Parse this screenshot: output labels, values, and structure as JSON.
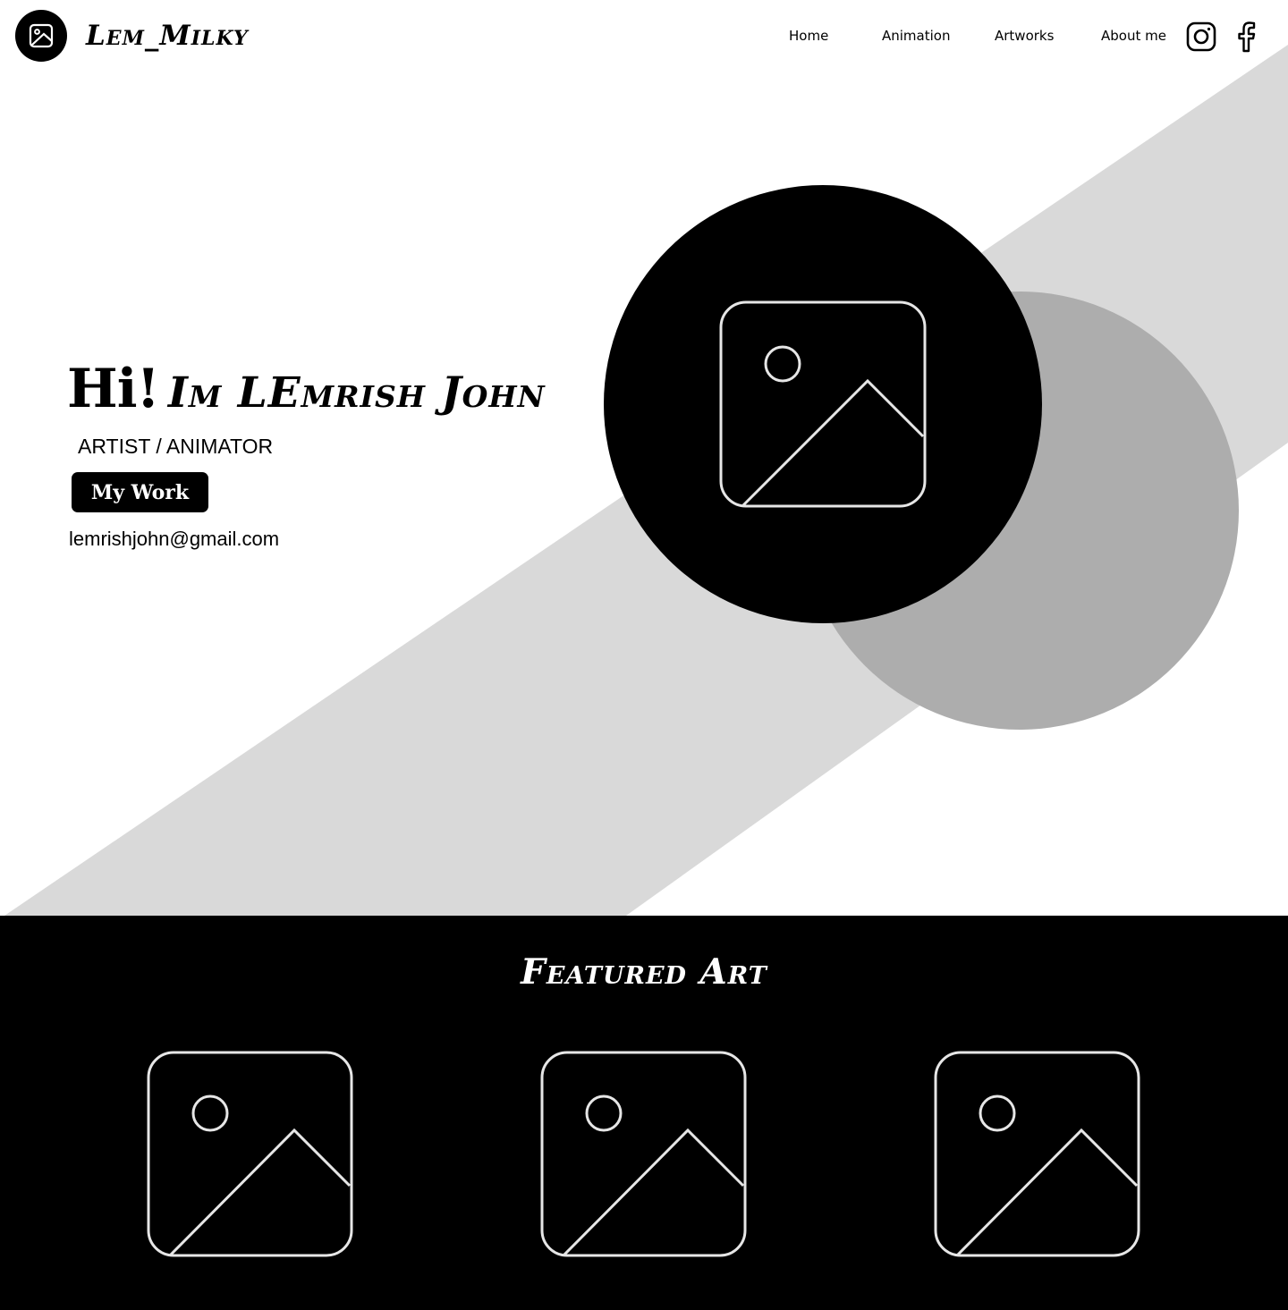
{
  "header": {
    "logo_icon": "image-placeholder-icon",
    "brand": "Lem_Milky",
    "nav": {
      "home": "Home",
      "animation": "Animation",
      "artworks": "Artworks",
      "about": "About me"
    },
    "social": {
      "instagram_icon": "instagram-icon",
      "facebook_icon": "facebook-icon"
    }
  },
  "hero": {
    "greeting": "Hi!",
    "name": "Im LEmrish John",
    "role": "ARTIST / ANIMATOR",
    "cta_label": "My Work",
    "email": "lemrishjohn@gmail.com",
    "portrait_icon": "image-placeholder-icon"
  },
  "featured": {
    "title": "Featured Art",
    "items": [
      {
        "icon": "image-placeholder-icon"
      },
      {
        "icon": "image-placeholder-icon"
      },
      {
        "icon": "image-placeholder-icon"
      }
    ]
  },
  "colors": {
    "black": "#000000",
    "white": "#ffffff",
    "band_gray": "#d9d9d9",
    "circle_gray": "#adadad",
    "icon_stroke": "#e6e6e6"
  }
}
